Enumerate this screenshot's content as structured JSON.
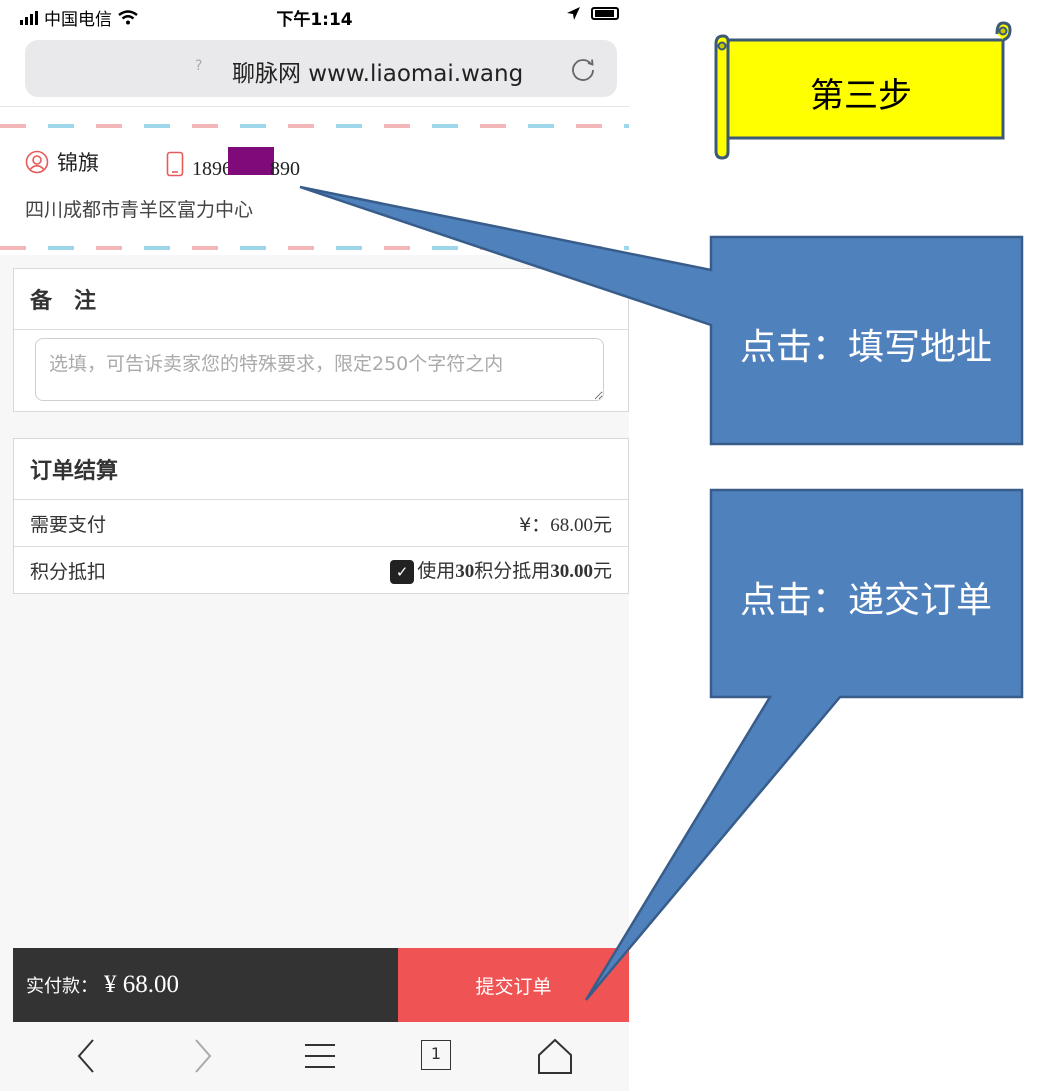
{
  "status_bar": {
    "carrier": "中国电信",
    "time": "下午1:14"
  },
  "browser": {
    "url_text": "聊脉网 www.liaomai.wang",
    "help_glyph": "?"
  },
  "address": {
    "name": "锦旗",
    "phone_prefix": "1896",
    "phone_suffix": "890",
    "detail": "四川成都市青羊区富力中心",
    "mask_color": "#7f0a7a"
  },
  "remark": {
    "title": "备　注",
    "placeholder": "选填，可告诉卖家您的特殊要求，限定250个字符之内"
  },
  "order_summary": {
    "title": "订单结算",
    "rows": [
      {
        "label": "需要支付",
        "prefix": "¥：",
        "value": "68.00",
        "unit": "元"
      },
      {
        "label": "积分抵扣",
        "text_a": "使用",
        "points": "30",
        "text_b": "积分抵用",
        "amount": "30.00",
        "unit": "元",
        "checked": true
      }
    ]
  },
  "footer": {
    "label": "实付款：",
    "amount": "¥ 68.00",
    "submit_label": "提交订单"
  },
  "toolbar": {
    "tabs_count": "1"
  },
  "annotations": {
    "step_label": "第三步",
    "callout_address": "点击：填写地址",
    "callout_submit": "点击：递交订单",
    "callout_color": "#4f81bd",
    "scroll_color": "#ffff00"
  },
  "colors": {
    "submit_bg": "#f05353",
    "footer_bg": "#333333"
  }
}
